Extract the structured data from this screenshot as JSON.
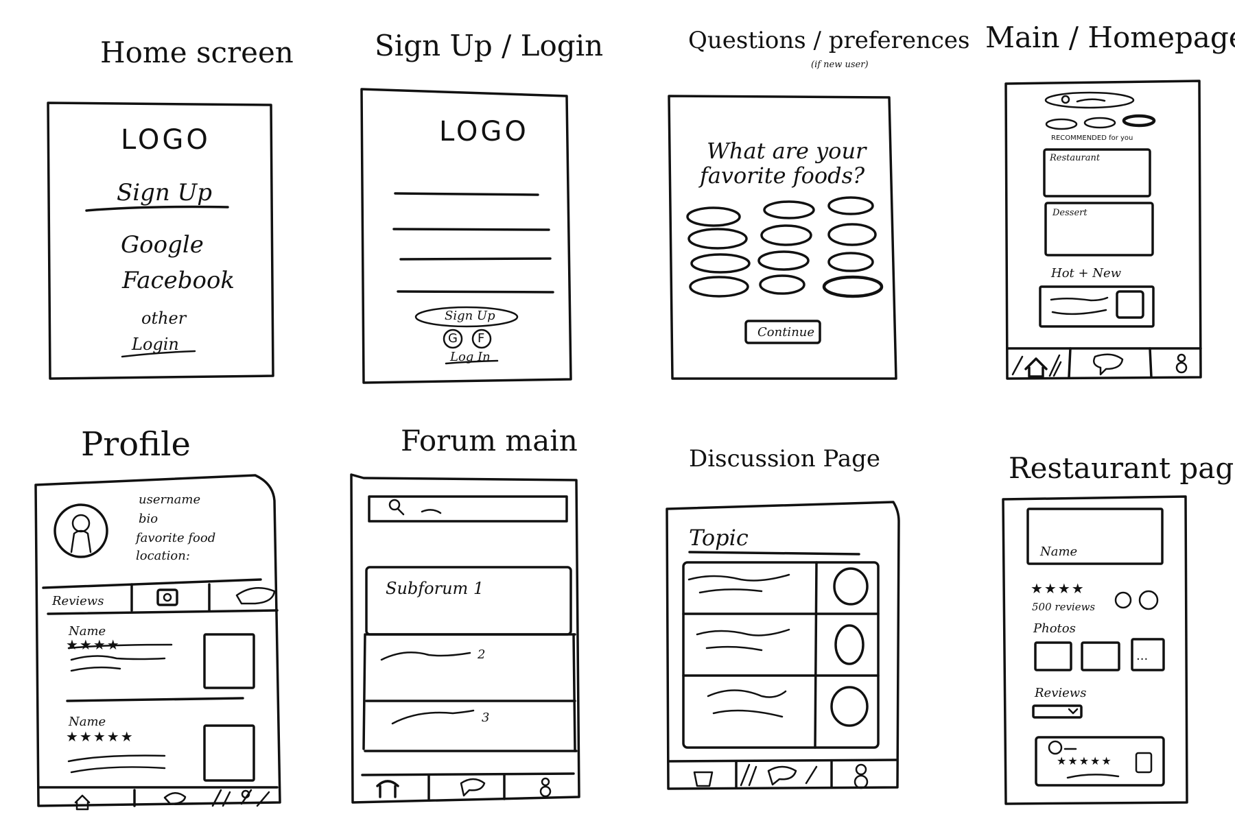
{
  "titles": {
    "home": "Home screen",
    "signup": "Sign Up / Login",
    "questions": "Questions / preferences",
    "questions_sub": "(if new user)",
    "main": "Main / Homepage",
    "profile": "Profile",
    "forum": "Forum main",
    "discussion": "Discussion Page",
    "restaurant": "Restaurant page"
  },
  "home": {
    "logo": "LOGO",
    "signup": "Sign Up",
    "google": "Google",
    "facebook": "Facebook",
    "other": "other",
    "login": "Login"
  },
  "signup": {
    "logo": "LOGO",
    "signup_button": "Sign Up",
    "google_icon": "G",
    "facebook_icon": "F",
    "login_link": "Log In"
  },
  "questions": {
    "prompt_line1": "What are your",
    "prompt_line2": "favorite foods?",
    "continue_button": "Continue"
  },
  "main": {
    "recommended": "RECOMMENDED for you",
    "card1": "Restaurant",
    "card2": "Dessert",
    "hot_new": "Hot + New"
  },
  "profile": {
    "username": "username",
    "bio": "bio",
    "favorite_food": "favorite food",
    "location": "location:",
    "reviews_tab": "Reviews",
    "review1_name": "Name",
    "review1_stars": "★★★★",
    "review2_name": "Name",
    "review2_stars": "★★★★★"
  },
  "forum": {
    "subforum1": "Subforum 1",
    "num2": "2",
    "num3": "3"
  },
  "discussion": {
    "topic": "Topic"
  },
  "restaurant": {
    "name": "Name",
    "stars": "★★★★",
    "reviews_count": "500 reviews",
    "photos": "Photos",
    "more": "...",
    "reviews": "Reviews",
    "review_stars": "★★★★★"
  }
}
